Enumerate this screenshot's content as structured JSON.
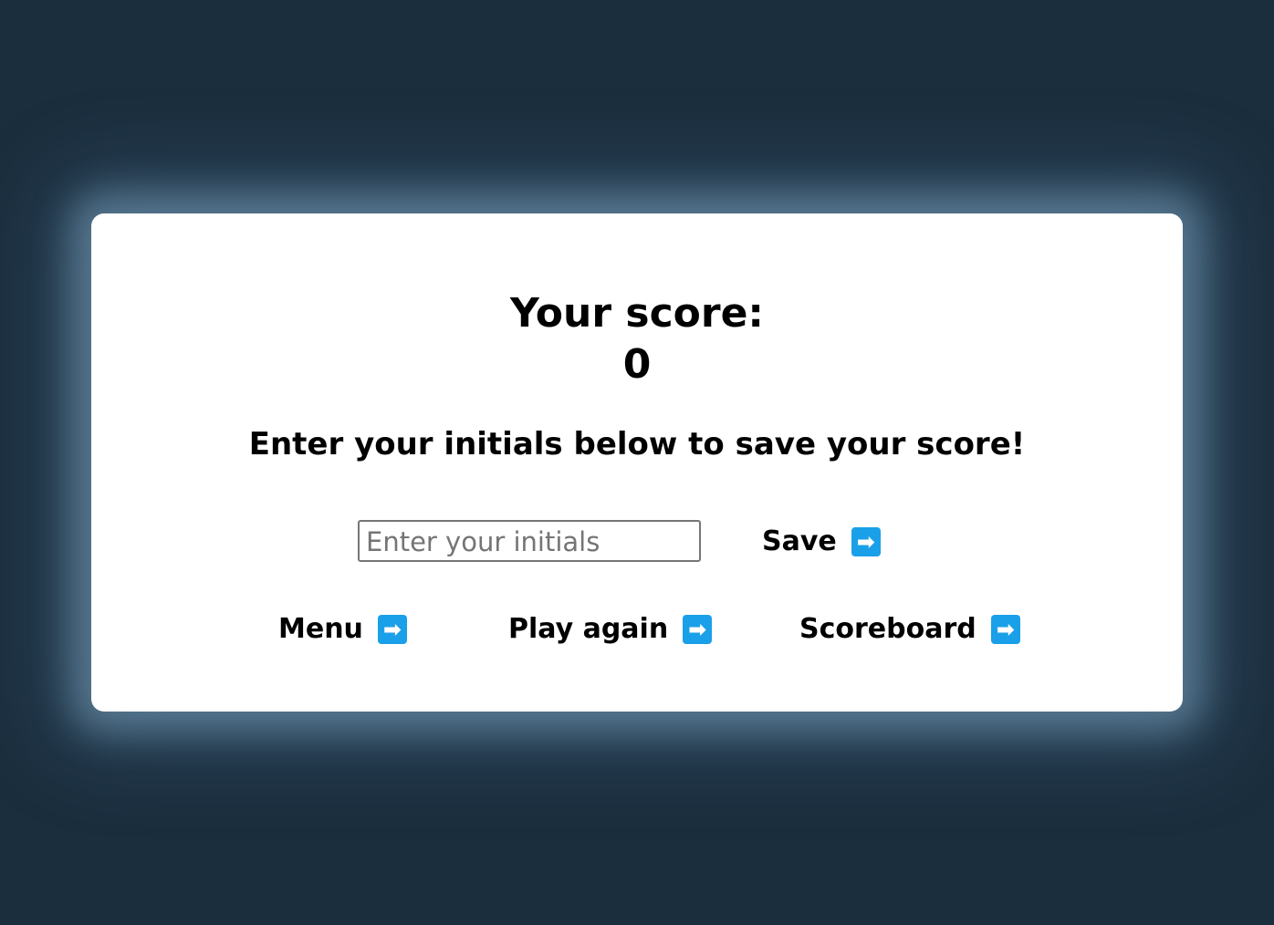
{
  "score": {
    "title": "Your score:",
    "value": "0"
  },
  "instructions": "Enter your initials below to save your score!",
  "initials_input": {
    "placeholder": "Enter your initials",
    "value": ""
  },
  "buttons": {
    "save_label": "Save",
    "menu_label": "Menu",
    "play_again_label": "Play again",
    "scoreboard_label": "Scoreboard",
    "arrow_icon": "➡"
  },
  "colors": {
    "background": "#1b2e3e",
    "card": "#ffffff",
    "arrow_accent": "#1aa0e8"
  }
}
